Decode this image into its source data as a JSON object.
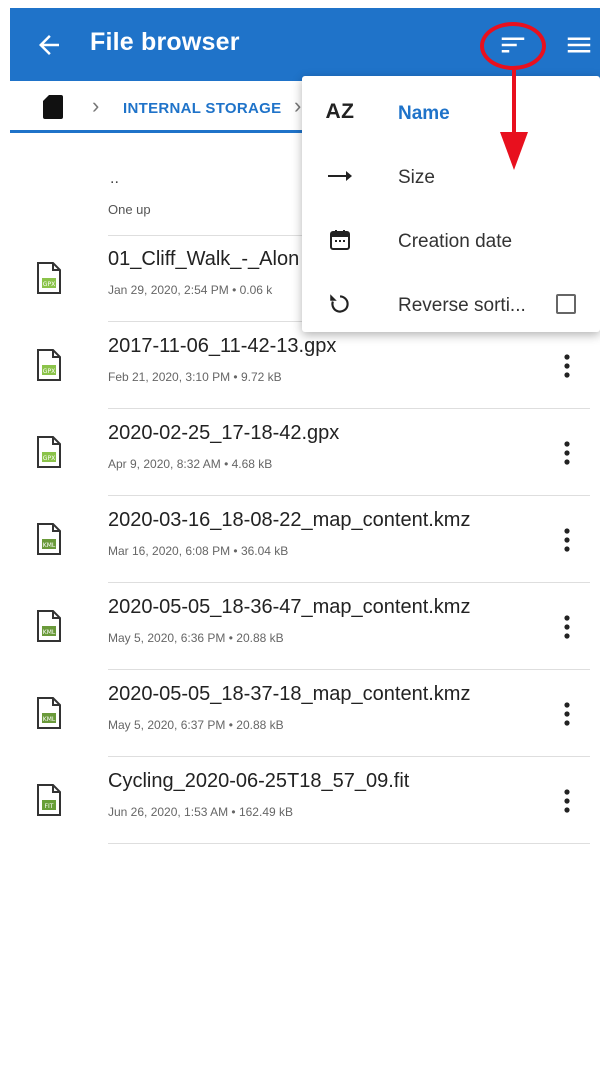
{
  "appbar": {
    "title": "File browser",
    "back_icon": "arrow-left-icon",
    "sort_icon": "sort-icon",
    "menu_icon": "hamburger-menu-icon",
    "color": "#1f73c9"
  },
  "breadcrumb": {
    "root_icon": "sd-card-icon",
    "storage_label": "INTERNAL STORAGE"
  },
  "list": {
    "up": {
      "dots": "..",
      "label": "One up"
    },
    "files": [
      {
        "name": "01_Cliff_Walk_-_Alon",
        "meta": "Jan 29, 2020, 2:54 PM • 0.06 k",
        "type": "GPX"
      },
      {
        "name": "2017-11-06_11-42-13.gpx",
        "meta": "Feb 21, 2020, 3:10 PM • 9.72 kB",
        "type": "GPX"
      },
      {
        "name": "2020-02-25_17-18-42.gpx",
        "meta": "Apr 9, 2020, 8:32 AM • 4.68 kB",
        "type": "GPX"
      },
      {
        "name": "2020-03-16_18-08-22_map_content.kmz",
        "meta": "Mar 16, 2020, 6:08 PM • 36.04 kB",
        "type": "KML"
      },
      {
        "name": "2020-05-05_18-36-47_map_content.kmz",
        "meta": "May 5, 2020, 6:36 PM • 20.88 kB",
        "type": "KML"
      },
      {
        "name": "2020-05-05_18-37-18_map_content.kmz",
        "meta": "May 5, 2020, 6:37 PM • 20.88 kB",
        "type": "KML"
      },
      {
        "name": "Cycling_2020-06-25T18_57_09.fit",
        "meta": "Jun 26, 2020, 1:53 AM • 162.49 kB",
        "type": "FIT"
      }
    ]
  },
  "sort_menu": {
    "options": [
      {
        "icon_text": "AZ",
        "label": "Name",
        "active": true
      },
      {
        "icon": "arrow-right-icon",
        "label": "Size"
      },
      {
        "icon": "calendar-icon",
        "label": "Creation date"
      },
      {
        "icon": "reverse-icon",
        "label": "Reverse sorti...",
        "checked": false
      }
    ]
  },
  "annotation": {
    "color": "#e8101e"
  }
}
